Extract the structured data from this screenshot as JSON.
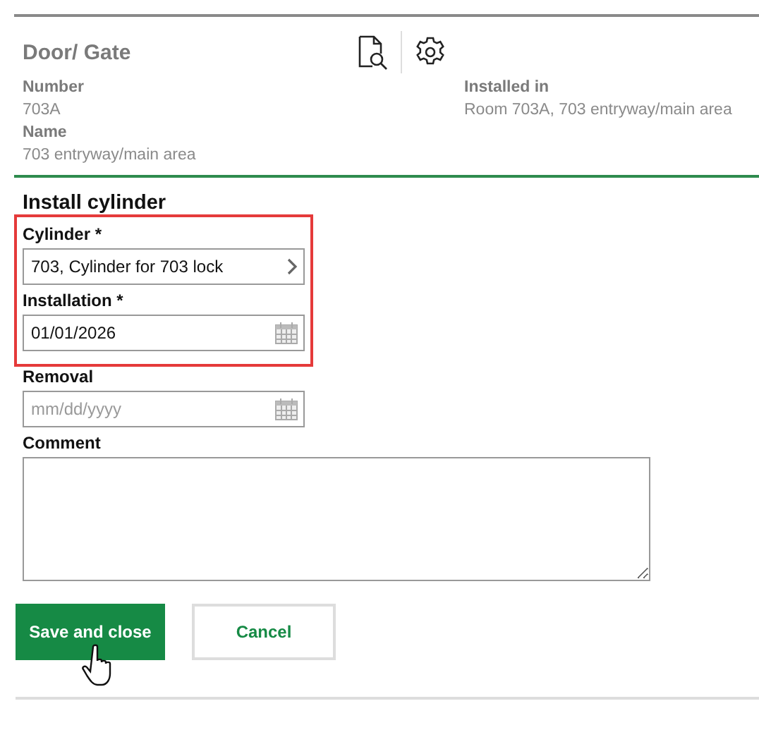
{
  "header": {
    "title": "Door/ Gate"
  },
  "details": [
    {
      "label": "Number",
      "value": "703A"
    },
    {
      "label": "Installed in",
      "value": "Room 703A, 703 entryway/main area"
    },
    {
      "label": "Name",
      "value": "703 entryway/main area"
    }
  ],
  "form": {
    "title": "Install cylinder",
    "groups": [
      {
        "highlighted": true,
        "fields": [
          {
            "kind": "select",
            "label": "Cylinder *",
            "value": "703, Cylinder for 703 lock"
          },
          {
            "kind": "date",
            "label": "Installation *",
            "value": "01/01/2026"
          }
        ]
      },
      {
        "highlighted": false,
        "fields": [
          {
            "kind": "date",
            "label": "Removal",
            "placeholder": "mm/dd/yyyy"
          },
          {
            "kind": "textarea",
            "label": "Comment"
          }
        ]
      }
    ]
  },
  "buttons": [
    {
      "kind": "primary",
      "label": "Save and close"
    },
    {
      "kind": "secondary",
      "label": "Cancel"
    }
  ]
}
